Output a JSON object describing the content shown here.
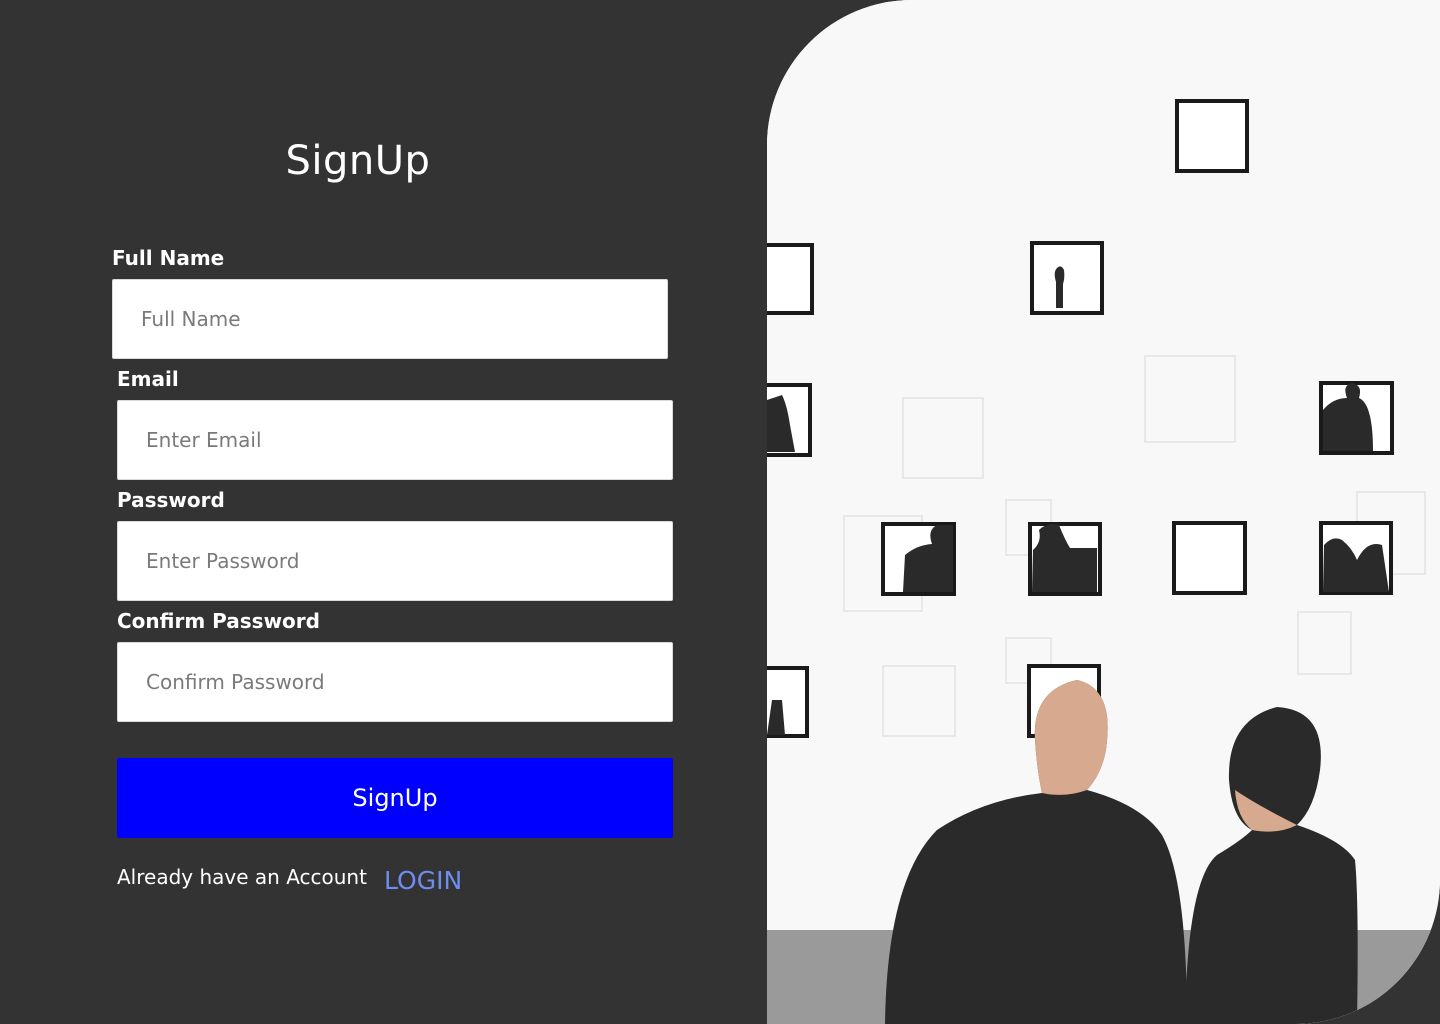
{
  "signup": {
    "title": "SignUp",
    "fields": [
      {
        "label": "Full Name",
        "placeholder": "Full Name"
      },
      {
        "label": "Email",
        "placeholder": "Enter Email"
      },
      {
        "label": "Password",
        "placeholder": "Enter Password"
      },
      {
        "label": "Confirm Password",
        "placeholder": "Confirm Password"
      }
    ],
    "button_label": "SignUp",
    "footer_text": "Already have an Account",
    "login_link": "LOGIN"
  },
  "colors": {
    "background": "#333333",
    "button": "#0000ff",
    "link": "#6f8df0"
  }
}
